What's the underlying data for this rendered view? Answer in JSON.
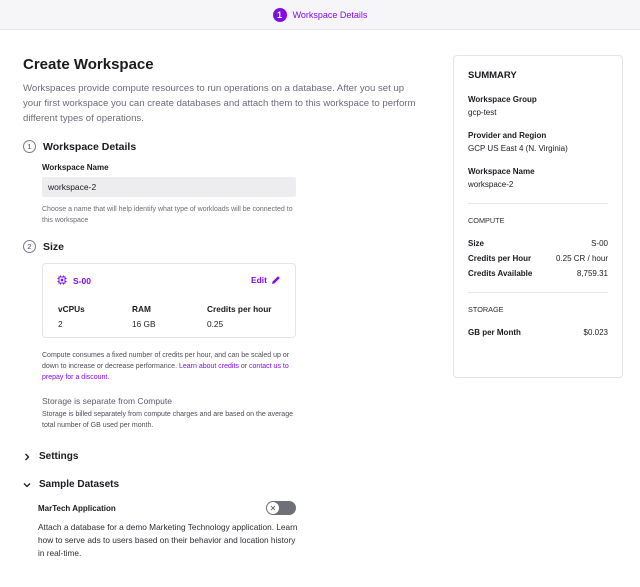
{
  "topbar": {
    "step_number": "1",
    "step_title": "Workspace Details"
  },
  "page": {
    "title": "Create Workspace",
    "intro": "Workspaces provide compute resources to run operations on a database. After you set up your first workspace you can create databases and attach them to this workspace to perform different types of operations."
  },
  "details": {
    "number": "1",
    "title": "Workspace Details",
    "name_label": "Workspace Name",
    "name_value": "workspace-2",
    "help": "Choose a name that will help identify what type of workloads will be connected to this workspace"
  },
  "size": {
    "number": "2",
    "title": "Size",
    "card_name": "S-00",
    "edit_label": "Edit",
    "specs": [
      {
        "label": "vCPUs",
        "value": "2"
      },
      {
        "label": "RAM",
        "value": "16 GB"
      },
      {
        "label": "Credits per hour",
        "value": "0.25"
      }
    ],
    "compute_note_1": "Compute consumes a fixed number of credits per hour, and can be scaled up or down to increase or decrease performance. ",
    "learn_credits": "Learn about credits",
    "or": " or ",
    "contact": "contact us to prepay for a discount.",
    "storage_heading": "Storage is separate from Compute",
    "storage_note": "Storage is billed separately from compute charges and are based on the average total number of GB used per month."
  },
  "settings": {
    "title": "Settings"
  },
  "sample_datasets": {
    "title": "Sample Datasets",
    "dataset_title": "MarTech Application",
    "dataset_desc": "Attach a database for a demo Marketing Technology application. Learn how to serve ads to users based on their behavior and location history in real-time."
  },
  "summary": {
    "title": "SUMMARY",
    "group_label": "Workspace Group",
    "group_value": "gcp-test",
    "provider_label": "Provider and Region",
    "provider_value": "GCP US East 4 (N. Virginia)",
    "name_label": "Workspace Name",
    "name_value": "workspace-2",
    "compute_heading": "COMPUTE",
    "compute_rows": [
      {
        "label": "Size",
        "value": "S-00"
      },
      {
        "label": "Credits per Hour",
        "value": "0.25 CR / hour"
      },
      {
        "label": "Credits Available",
        "value": "8,759.31"
      }
    ],
    "storage_heading": "STORAGE",
    "storage_rows": [
      {
        "label": "GB per Month",
        "value": "$0.023"
      }
    ]
  },
  "colors": {
    "accent": "#820ddf",
    "toggle_off": "#6f6f78"
  },
  "icons": {
    "chip": "chip-icon",
    "edit": "pencil-icon",
    "chevron_right": "chevron-right-icon",
    "chevron_down": "chevron-down-icon",
    "toggle_x": "close-icon"
  }
}
